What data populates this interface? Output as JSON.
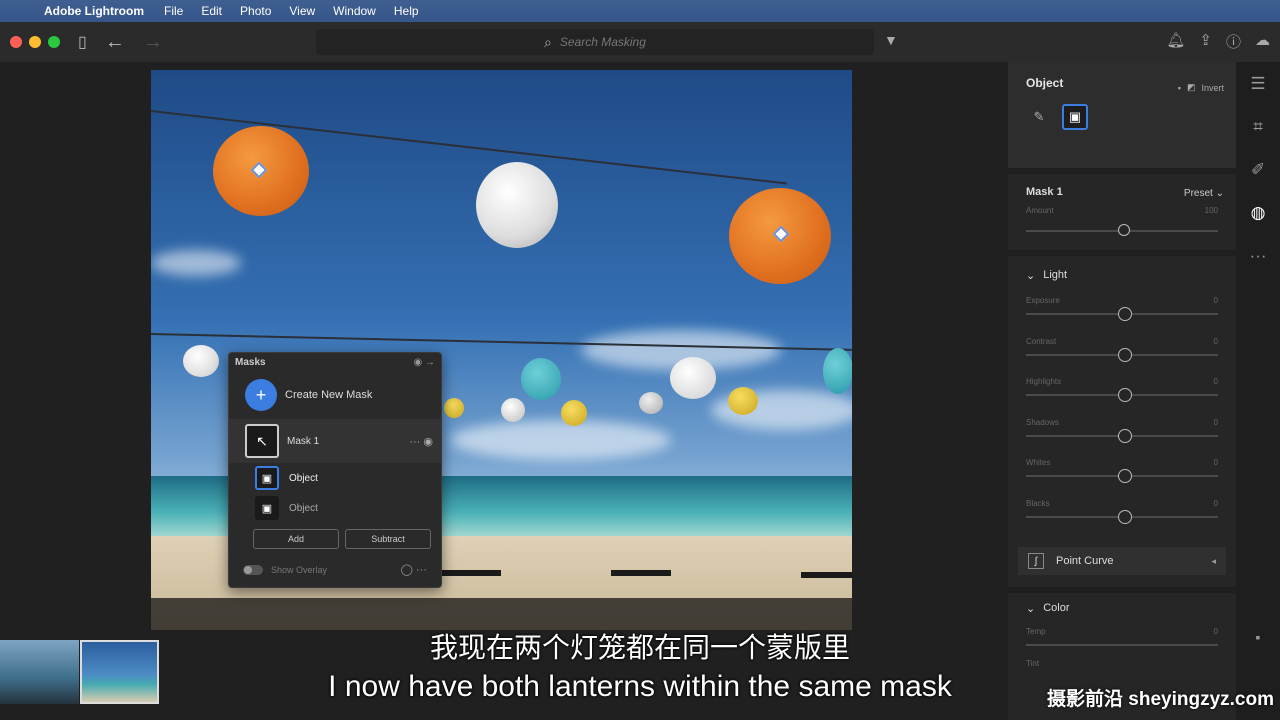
{
  "menubar": {
    "app_name": "Adobe Lightroom",
    "items": [
      "File",
      "Edit",
      "Photo",
      "View",
      "Window",
      "Help"
    ]
  },
  "toolbar": {
    "search_placeholder": "Search Masking"
  },
  "masks_panel": {
    "title": "Masks",
    "create_label": "Create New Mask",
    "mask_name": "Mask 1",
    "sub_items": [
      "Object",
      "Object"
    ],
    "add_label": "Add",
    "subtract_label": "Subtract",
    "overlay_label": "Show Overlay"
  },
  "right_panel": {
    "object_title": "Object",
    "invert_label": "Invert",
    "mask_name": "Mask 1",
    "preset_label": "Preset",
    "amount_label": "Amount",
    "amount_value": "100",
    "light_label": "Light",
    "sliders": [
      {
        "label": "Exposure",
        "value": "0"
      },
      {
        "label": "Contrast",
        "value": "0"
      },
      {
        "label": "Highlights",
        "value": "0"
      },
      {
        "label": "Shadows",
        "value": "0"
      },
      {
        "label": "Whites",
        "value": "0"
      },
      {
        "label": "Blacks",
        "value": "0"
      }
    ],
    "point_curve_label": "Point Curve",
    "color_label": "Color",
    "temp_label": "Temp",
    "temp_value": "0",
    "tint_label": "Tint"
  },
  "subtitles": {
    "chinese": "我现在两个灯笼都在同一个蒙版里",
    "english": "I now have both lanterns within the same mask"
  },
  "watermark": "摄影前沿 sheyingzyz.com",
  "colors": {
    "accent": "#3b7de1",
    "menubar": "#3a5a8e",
    "panel": "#262626"
  }
}
